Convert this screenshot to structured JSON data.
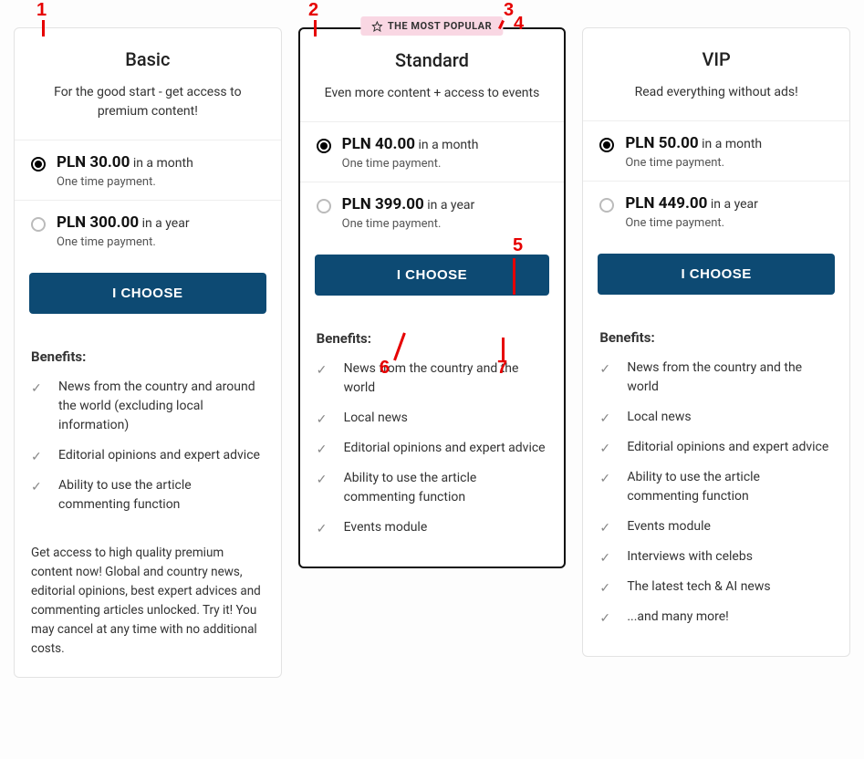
{
  "badge": "THE MOST POPULAR",
  "choose_label": "I CHOOSE",
  "benefits_heading": "Benefits:",
  "plans": [
    {
      "title": "Basic",
      "subtitle": "For the good start - get access to premium content!",
      "options": [
        {
          "amount": "PLN 30.00",
          "period": "in a month",
          "note": "One time payment.",
          "selected": true
        },
        {
          "amount": "PLN 300.00",
          "period": "in a year",
          "note": "One time payment.",
          "selected": false
        }
      ],
      "benefits": [
        "News from the country and around the world (excluding local information)",
        "Editorial opinions and expert advice",
        "Ability to use the article commenting function"
      ],
      "footer": "Get access to high quality premium content now! Global and country news, editorial opinions, best expert advices and commenting articles unlocked. Try it! You may cancel at any time with no additional costs."
    },
    {
      "title": "Standard",
      "subtitle": "Even more content + access to events",
      "popular": true,
      "options": [
        {
          "amount": "PLN 40.00",
          "period": "in a month",
          "note": "One time payment.",
          "selected": true
        },
        {
          "amount": "PLN 399.00",
          "period": "in a year",
          "note": "One time payment.",
          "selected": false
        }
      ],
      "benefits": [
        "News from the country and the world",
        "Local news",
        "Editorial opinions and expert advice",
        "Ability to use the article commenting function",
        "Events module"
      ]
    },
    {
      "title": "VIP",
      "subtitle": "Read everything without ads!",
      "options": [
        {
          "amount": "PLN 50.00",
          "period": "in a month",
          "note": "One time payment.",
          "selected": true
        },
        {
          "amount": "PLN 449.00",
          "period": "in a year",
          "note": "One time payment.",
          "selected": false
        }
      ],
      "benefits": [
        "News from the country and the world",
        "Local news",
        "Editorial opinions and expert advice",
        "Ability to use the article commenting function",
        "Events module",
        "Interviews with celebs",
        "The latest tech & AI news",
        "...and many more!"
      ]
    }
  ],
  "annotations": [
    "1",
    "2",
    "3",
    "4",
    "5",
    "6",
    "7"
  ]
}
